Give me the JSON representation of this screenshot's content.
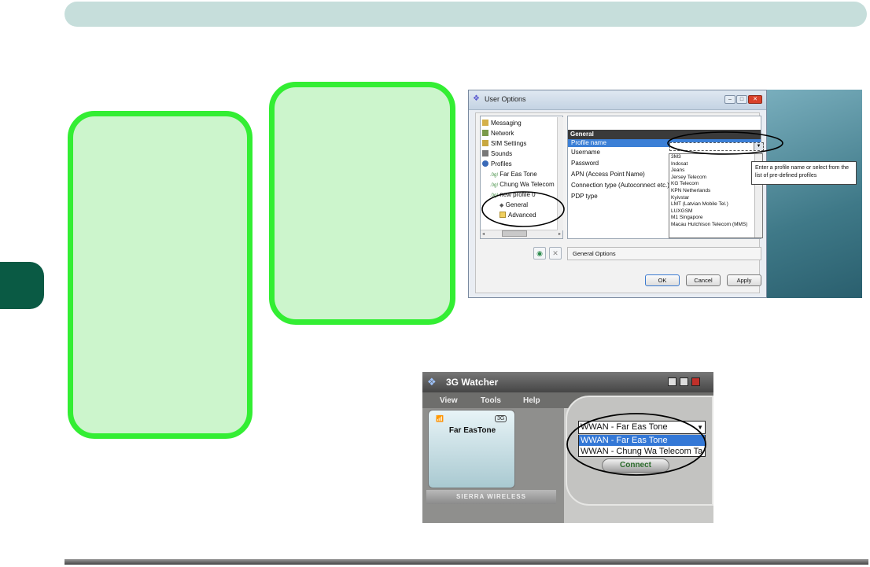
{
  "user_options": {
    "title": "User Options",
    "tree": [
      "Messaging",
      "Network",
      "SIM Settings",
      "Sounds",
      "Profiles",
      "Far Eas Tone",
      "Chung Wa Telecom",
      "new profile 0",
      "General",
      "Advanced"
    ],
    "section_header": "General",
    "properties": [
      "Profile name",
      "Username",
      "Password",
      "APN (Access Point Name)",
      "Connection type (Autoconnect etc.)",
      "PDP type"
    ],
    "dropdown_items": [
      "3M3",
      "Indosat",
      "Jeans",
      "Jersey Telecom",
      "KG Telecom",
      "KPN Netherlands",
      "Kyivstar",
      "LMT (Latvian Mobile Tel.)",
      "LUXGSM",
      "M1 Singapore",
      "Macau Hutchison Telecom (MMS)"
    ],
    "tooltip": "Enter a profile name or select from the list of pre-defined profiles",
    "status_text": "General Options",
    "buttons": {
      "ok": "OK",
      "cancel": "Cancel",
      "apply": "Apply"
    }
  },
  "watcher": {
    "title": "3G Watcher",
    "menu": [
      "View",
      "Tools",
      "Help"
    ],
    "carrier": "Far EasTone",
    "network_badge": "3G",
    "brand": "SIERRA WIRELESS",
    "selected_profile": "WWAN - Far Eas Tone",
    "profile_options": [
      "WWAN - Far Eas Tone",
      "WWAN - Chung Wa Telecom Ta"
    ],
    "connect_label": "Connect"
  },
  "colors": {
    "header": "#c6dedb",
    "side_tab": "#0a5a44",
    "callout_border": "#33ee33",
    "highlight": "#3b7fd6"
  }
}
